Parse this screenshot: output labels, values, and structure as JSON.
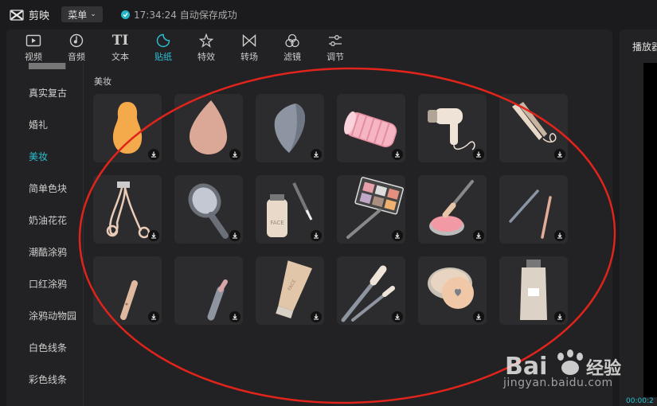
{
  "app": {
    "name": "剪映",
    "menu_label": "菜单",
    "status_text": "17:34:24 自动保存成功"
  },
  "tabs": [
    {
      "label": "视频",
      "icon": "video-icon"
    },
    {
      "label": "音频",
      "icon": "audio-icon"
    },
    {
      "label": "文本",
      "icon": "text-icon"
    },
    {
      "label": "贴纸",
      "icon": "sticker-icon",
      "active": true
    },
    {
      "label": "特效",
      "icon": "effects-icon"
    },
    {
      "label": "转场",
      "icon": "transition-icon"
    },
    {
      "label": "滤镜",
      "icon": "filter-icon"
    },
    {
      "label": "调节",
      "icon": "adjust-icon"
    }
  ],
  "sidebar": {
    "items": [
      {
        "label": "真实复古"
      },
      {
        "label": "婚礼"
      },
      {
        "label": "美妆",
        "active": true
      },
      {
        "label": "简单色块"
      },
      {
        "label": "奶油花花"
      },
      {
        "label": "潮酷涂鸦"
      },
      {
        "label": "口红涂鸦"
      },
      {
        "label": "涂鸦动物园"
      },
      {
        "label": "白色线条"
      },
      {
        "label": "彩色线条"
      }
    ]
  },
  "section_title": "美妆",
  "stickers": [
    {
      "name": "orange-beauty-sponge"
    },
    {
      "name": "pink-beauty-sponge"
    },
    {
      "name": "gray-beauty-sponge"
    },
    {
      "name": "pink-hair-roller"
    },
    {
      "name": "hair-dryer"
    },
    {
      "name": "hair-straightener"
    },
    {
      "name": "eyelash-curler"
    },
    {
      "name": "hand-mirror"
    },
    {
      "name": "face-serum-dropper"
    },
    {
      "name": "eyeshadow-palette-brush"
    },
    {
      "name": "blush-compact-brush"
    },
    {
      "name": "eyeliner-pencils"
    },
    {
      "name": "concealer-stick"
    },
    {
      "name": "lipstick"
    },
    {
      "name": "face-cream-tube"
    },
    {
      "name": "makeup-brushes"
    },
    {
      "name": "powder-puff-compact"
    },
    {
      "name": "cream-bottle"
    }
  ],
  "right_panel": {
    "title": "播放器",
    "time": "00:00:2"
  },
  "watermark": {
    "text": "jingyan.baidu.com"
  },
  "colors": {
    "accent": "#29c2d4",
    "highlight": "#e0241b"
  }
}
